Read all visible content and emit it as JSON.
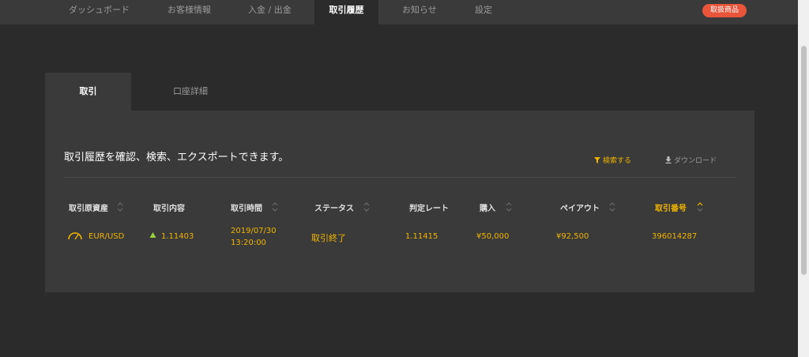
{
  "nav": {
    "items": [
      {
        "label": "ダッシュボード"
      },
      {
        "label": "お客様情報"
      },
      {
        "label": "入金 / 出金"
      },
      {
        "label": "取引履歴"
      },
      {
        "label": "お知らせ"
      },
      {
        "label": "設定"
      }
    ],
    "active": "取引履歴",
    "badge": "取扱商品"
  },
  "colors": {
    "accent": "#f0b400",
    "badge": "#e8553a",
    "background": "#2b2b2b",
    "panel": "#3a3a3a"
  },
  "tabs": [
    {
      "label": "取引",
      "active": true
    },
    {
      "label": "口座詳細",
      "active": false
    }
  ],
  "main": {
    "title": "取引履歴を確認、検索、エクスポートできます。",
    "search_label": "検索する",
    "download_label": "ダウンロード",
    "icons": {
      "search": "filter-icon",
      "download": "download-icon",
      "asset": "gauge-icon",
      "direction": "up-arrow-icon"
    }
  },
  "table": {
    "headers": [
      {
        "label": "取引原資産",
        "sortable": true
      },
      {
        "label": "取引内容",
        "sortable": false
      },
      {
        "label": "取引時間",
        "sortable": true
      },
      {
        "label": "ステータス",
        "sortable": true
      },
      {
        "label": "判定レート",
        "sortable": false
      },
      {
        "label": "購入",
        "sortable": true
      },
      {
        "label": "ペイアウト",
        "sortable": true
      },
      {
        "label": "取引番号",
        "sortable": true,
        "sorted": true
      }
    ],
    "rows": [
      {
        "asset": "EUR/USD",
        "content": "1.11403",
        "time_date": "2019/07/30",
        "time_clock": "13:20:00",
        "status": "取引終了",
        "rate": "1.11415",
        "purchase": "¥50,000",
        "payout": "¥92,500",
        "number": "396014287"
      }
    ]
  }
}
